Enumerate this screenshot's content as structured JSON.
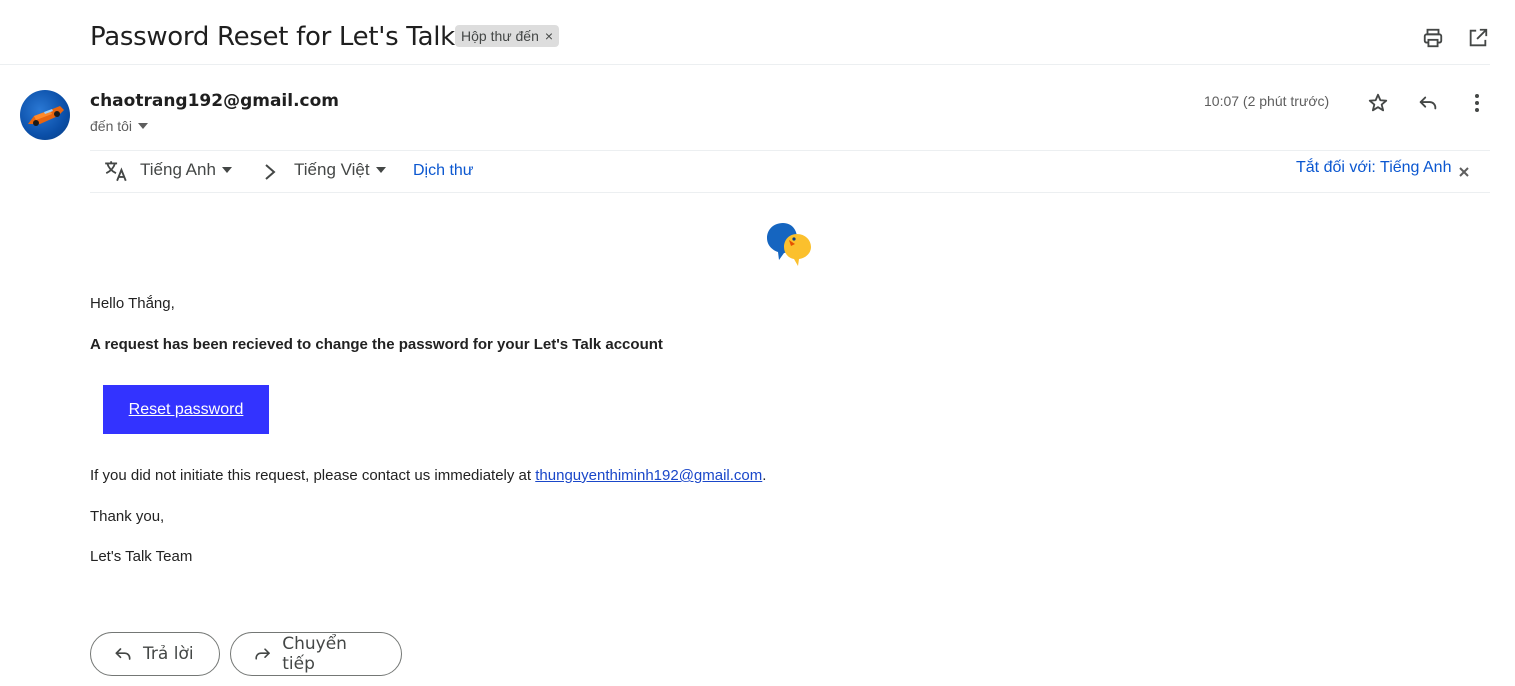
{
  "header": {
    "subject": "Password Reset for Let's Talk",
    "label": "Hộp thư đến",
    "label_close": "×"
  },
  "message": {
    "sender": "chaotrang192@gmail.com",
    "recipient": "đến tôi",
    "time": "10:07 (2 phút trước)"
  },
  "translate": {
    "from_lang": "Tiếng Anh",
    "to_lang": "Tiếng Việt",
    "translate_link": "Dịch thư",
    "turn_off": "Tắt đối với: Tiếng Anh"
  },
  "email_body": {
    "greeting": "Hello Thắng,",
    "headline": "A request has been recieved to change the password for your Let's Talk account",
    "button_label": "Reset password",
    "contact_prefix": "If you did not initiate this request, please contact us immediately at ",
    "contact_email": "thunguyenthiminh192@gmail.com",
    "contact_suffix": ".",
    "thanks": "Thank you,",
    "signature": "Let's Talk Team"
  },
  "actions": {
    "reply": "Trả lời",
    "forward": "Chuyển tiếp"
  },
  "colors": {
    "primary_button": "#3333ff",
    "link": "#0b57d0",
    "logo_blue": "#1565c0",
    "logo_yellow": "#fbc02d"
  }
}
